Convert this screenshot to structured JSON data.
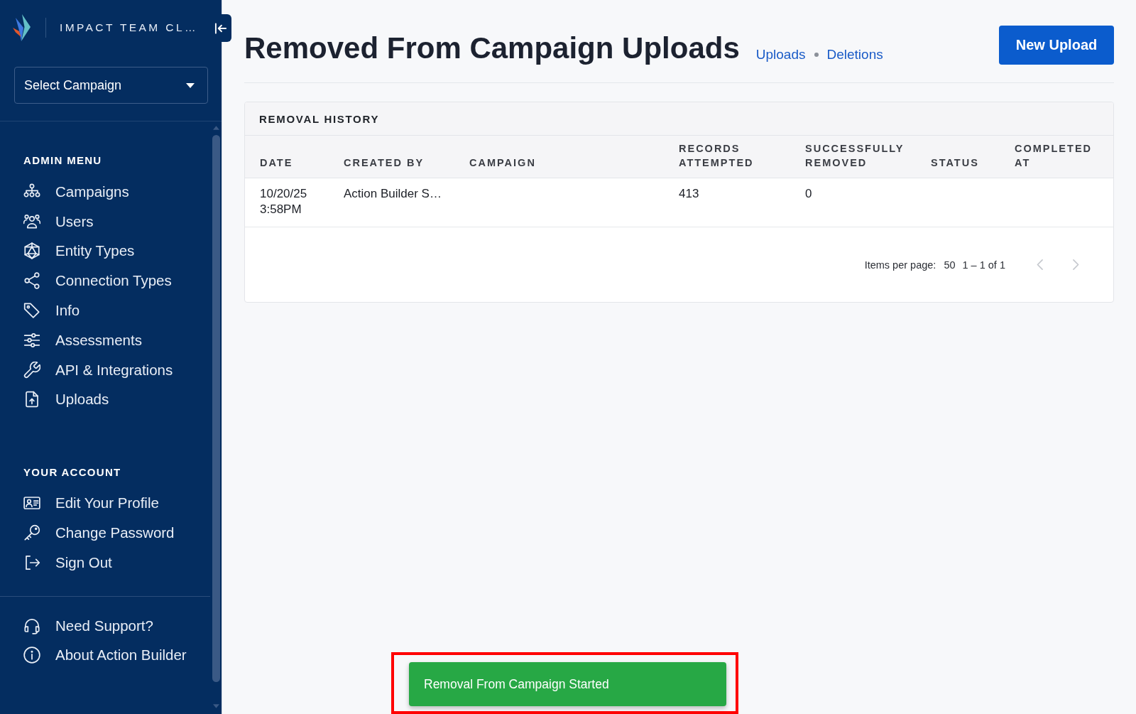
{
  "sidebar": {
    "brand": "IMPACT TEAM CL…",
    "campaign_select": {
      "label": "Select Campaign"
    },
    "sections": [
      {
        "heading": "ADMIN MENU",
        "items": [
          {
            "label": "Campaigns"
          },
          {
            "label": "Users"
          },
          {
            "label": "Entity Types"
          },
          {
            "label": "Connection Types"
          },
          {
            "label": "Info"
          },
          {
            "label": "Assessments"
          },
          {
            "label": "API & Integrations"
          },
          {
            "label": "Uploads"
          }
        ]
      },
      {
        "heading": "YOUR ACCOUNT",
        "items": [
          {
            "label": "Edit Your Profile"
          },
          {
            "label": "Change Password"
          },
          {
            "label": "Sign Out"
          }
        ]
      }
    ],
    "footer_items": [
      {
        "label": "Need Support?"
      },
      {
        "label": "About Action Builder"
      }
    ]
  },
  "header": {
    "title": "Removed From Campaign Uploads",
    "links": [
      {
        "label": "Uploads"
      },
      {
        "label": "Deletions"
      }
    ],
    "new_upload_button": "New Upload"
  },
  "removal_history": {
    "title": "REMOVAL HISTORY",
    "columns": [
      "DATE",
      "CREATED BY",
      "CAMPAIGN",
      "RECORDS ATTEMPTED",
      "SUCCESSFULLY REMOVED",
      "STATUS",
      "COMPLETED AT"
    ],
    "rows": [
      {
        "date": "10/20/25 3:58PM",
        "created_by": "Action Builder S…",
        "records_attempted": "413",
        "successfully_removed": "0"
      }
    ],
    "pagination": {
      "items_per_page_label": "Items per page:",
      "page_size": "50",
      "range": "1 – 1 of 1",
      "previous": {
        "disabled": true
      },
      "next": {
        "disabled": true
      }
    }
  },
  "toast": {
    "message": "Removal From Campaign Started",
    "highlighted": true
  }
}
